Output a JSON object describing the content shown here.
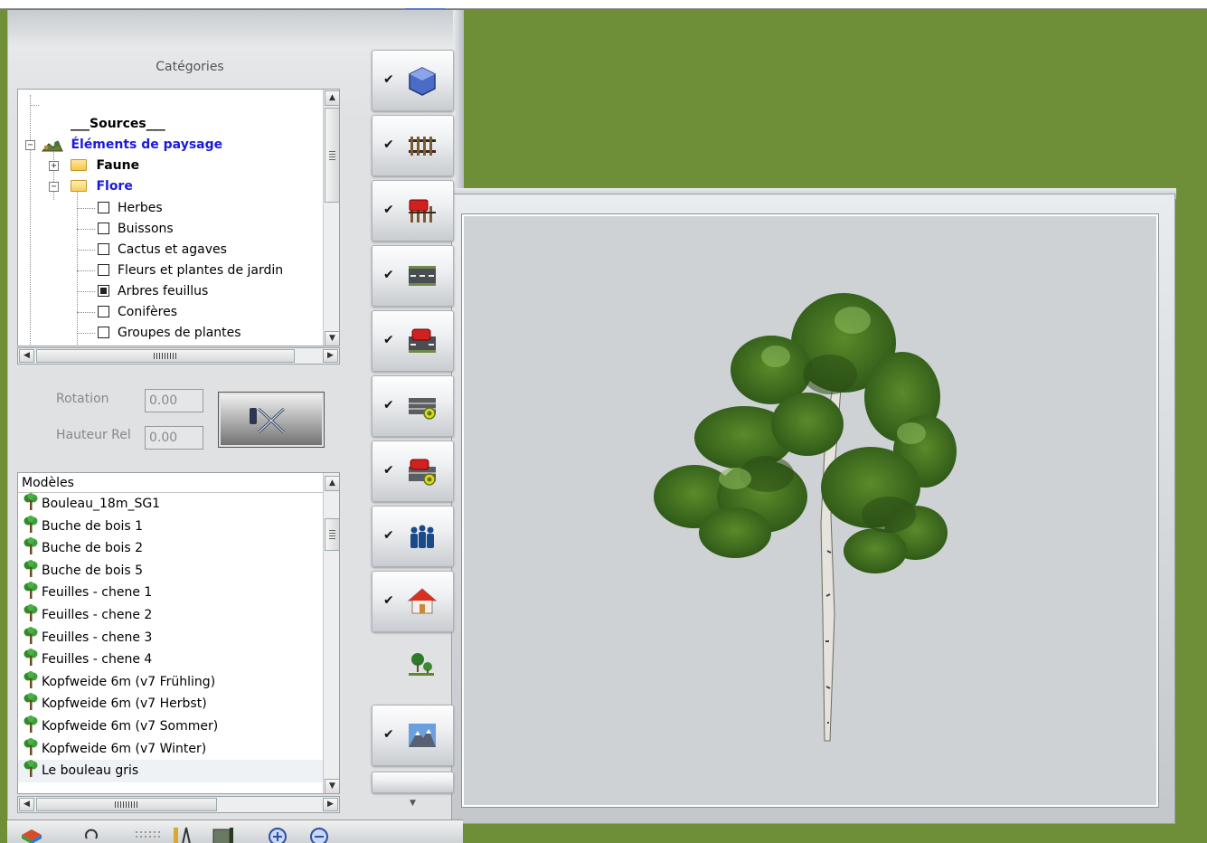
{
  "categories": {
    "title": "Catégories",
    "tree": [
      {
        "label": "___Sources___",
        "bold": true,
        "color": "#000000"
      },
      {
        "label": "Éléments de paysage",
        "bold": true,
        "color": "#1a1adc",
        "icon": "landscape-icon",
        "expander": "minus"
      },
      {
        "label": "Faune",
        "bold": true,
        "color": "#000000",
        "icon": "folder-icon",
        "expander": "plus"
      },
      {
        "label": "Flore",
        "bold": true,
        "color": "#1a1adc",
        "icon": "folder-open-icon",
        "expander": "minus"
      },
      {
        "label": "Herbes",
        "checked": false
      },
      {
        "label": "Buissons",
        "checked": false
      },
      {
        "label": "Cactus et agaves",
        "checked": false
      },
      {
        "label": "Fleurs et plantes de jardin",
        "checked": false
      },
      {
        "label": "Arbres feuillus",
        "checked": true
      },
      {
        "label": "Conifères",
        "checked": false
      },
      {
        "label": "Groupes de plantes",
        "checked": false
      }
    ]
  },
  "controls": {
    "rotation_label": "Rotation",
    "rotation_value": "0.00",
    "height_label": "Hauteur Rel",
    "height_value": "0.00"
  },
  "models": {
    "header": "Modèles",
    "items": [
      "Bouleau_18m_SG1",
      "Buche de bois 1",
      "Buche de bois 2",
      "Buche de bois 5",
      "Feuilles - chene 1",
      "Feuilles - chene 2",
      "Feuilles - chene 3",
      "Feuilles - chene 4",
      "Kopfweide 6m (v7 Frühling)",
      "Kopfweide 6m (v7 Herbst)",
      "Kopfweide 6m (v7 Sommer)",
      "Kopfweide 6m (v7 Winter)",
      "Le bouleau gris"
    ],
    "selected": "Le bouleau gris"
  },
  "toolstrip": {
    "buttons": [
      {
        "name": "terrain-icon",
        "checked": true
      },
      {
        "name": "rail-track-icon",
        "checked": true
      },
      {
        "name": "rail-vehicle-icon",
        "checked": true
      },
      {
        "name": "road-icon",
        "checked": true
      },
      {
        "name": "road-vehicle-icon",
        "checked": true
      },
      {
        "name": "tram-track-icon",
        "checked": true
      },
      {
        "name": "tram-vehicle-icon",
        "checked": true
      },
      {
        "name": "people-icon",
        "checked": true
      },
      {
        "name": "house-icon",
        "checked": true
      },
      {
        "name": "landscape-trees-icon",
        "checked": false,
        "active": true
      },
      {
        "name": "mountain-icon",
        "checked": true
      }
    ],
    "checkmark": "✔"
  },
  "colors": {
    "accent_blue": "#1a1adc",
    "ground_green": "#6e8e38",
    "preview_bg": "#cfd2d5"
  }
}
